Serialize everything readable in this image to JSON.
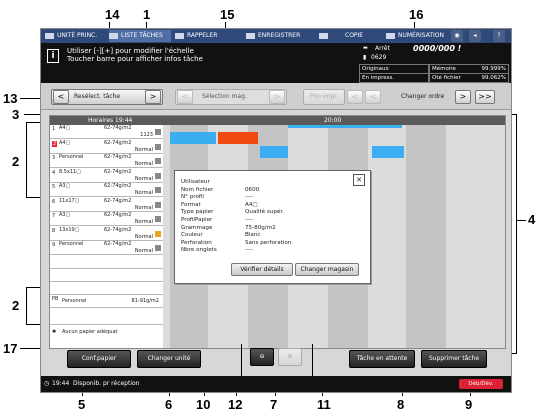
{
  "callouts": {
    "n1": "1",
    "n2a": "2",
    "n2b": "2",
    "n3": "3",
    "n4": "4",
    "n5": "5",
    "n6": "6",
    "n7": "7",
    "n8": "8",
    "n9": "9",
    "n10": "10",
    "n11": "11",
    "n12": "12",
    "n13": "13",
    "n14": "14",
    "n15": "15",
    "n16": "16",
    "n17": "17"
  },
  "tabs": {
    "unite": "UNITÉ PRINC.",
    "liste": "LISTE TÂCHES",
    "rappel": "RAPPELER",
    "enreg": "ENREGISTRER",
    "copie": "COPIE",
    "numeri": "NUMÉRISATION",
    "help": "?"
  },
  "info": {
    "message_line1": "Utiliser [-][+] pour modifier l'échelle",
    "message_line2": "Toucher barre pour afficher infos tâche",
    "state": "Arrêt",
    "counter": "0000/000 !",
    "job_count": "0629",
    "originals": "Originaux",
    "in_print": "En impress.",
    "memory_label": "Mémoire",
    "memory_value": "99.999%",
    "hdd_label": "Oté fichier",
    "hdd_value": "99.062%"
  },
  "controls": {
    "reselect": "Resélect. tâche",
    "select_mag": "Sélection mag.",
    "prio": "Prio impr.",
    "change_order": "Changer ordre",
    "prev_arrow": "<",
    "next_arrow": ">",
    "last_arrow": ">>"
  },
  "timeline": {
    "hours_label": "Horaires 19:44",
    "time_mark": "20:00"
  },
  "trays": [
    {
      "num": "1",
      "line1": "A4▢",
      "line2": "1123",
      "weight": "62-74g/m2"
    },
    {
      "num": "2",
      "line1": "A4▢",
      "line2": "Normal",
      "weight": "62-74g/m2"
    },
    {
      "num": "3",
      "line1": "Personnel",
      "line2": "Normal",
      "weight": "62-74g/m2"
    },
    {
      "num": "4",
      "line1": "8.5x11▢",
      "line2": "Normal",
      "weight": "62-74g/m2"
    },
    {
      "num": "5",
      "line1": "A3▢",
      "line2": "Normal",
      "weight": "62-74g/m2"
    },
    {
      "num": "6",
      "line1": "11x17▢",
      "line2": "Normal",
      "weight": "62-74g/m2"
    },
    {
      "num": "7",
      "line1": "A3▢",
      "line2": "Normal",
      "weight": "62-74g/m2"
    },
    {
      "num": "8",
      "line1": "13x19▢",
      "line2": "Normal",
      "weight": "62-74g/m2"
    },
    {
      "num": "9",
      "line1": "Personnel",
      "line2": "Normal",
      "weight": "62-74g/m2"
    }
  ],
  "pb_tray": {
    "num": "PB",
    "line1": "Personnel",
    "weight": "81-91g/m2"
  },
  "no_paper": "Aucun papier adéquat",
  "dialog": {
    "close": "✕",
    "rows": [
      {
        "label": "Utilisateur",
        "value": ""
      },
      {
        "label": "Nom fichier",
        "value": "0600"
      },
      {
        "label": "N° profil",
        "value": "----"
      },
      {
        "label": "Format",
        "value": "A4▢"
      },
      {
        "label": "Type papier",
        "value": "Qualité supér."
      },
      {
        "label": "ProfilPapier",
        "value": "----"
      },
      {
        "label": "Grammage",
        "value": "75-80g/m2"
      },
      {
        "label": "Couleur",
        "value": "Blanc"
      },
      {
        "label": "Perforation",
        "value": "Sans perforation"
      },
      {
        "label": "Nbre onglets",
        "value": "----"
      }
    ],
    "verify": "Vérifier détails",
    "change_mag": "Changer magasin"
  },
  "bottom": {
    "conf_paper": "Conf.papier",
    "change_unit": "Changer unité",
    "zoom_out": "🔍−",
    "zoom_in": "🔍+",
    "pending": "Tâche en attente",
    "delete": "Supprimer tâche"
  },
  "status": {
    "time": "19:44",
    "text": "Disponib. pr réception",
    "badge": "Déb/Dév."
  },
  "colors": {
    "cyan": "#3aaef0",
    "orange": "#f04a12",
    "tabbar": "#2f4a7a"
  }
}
